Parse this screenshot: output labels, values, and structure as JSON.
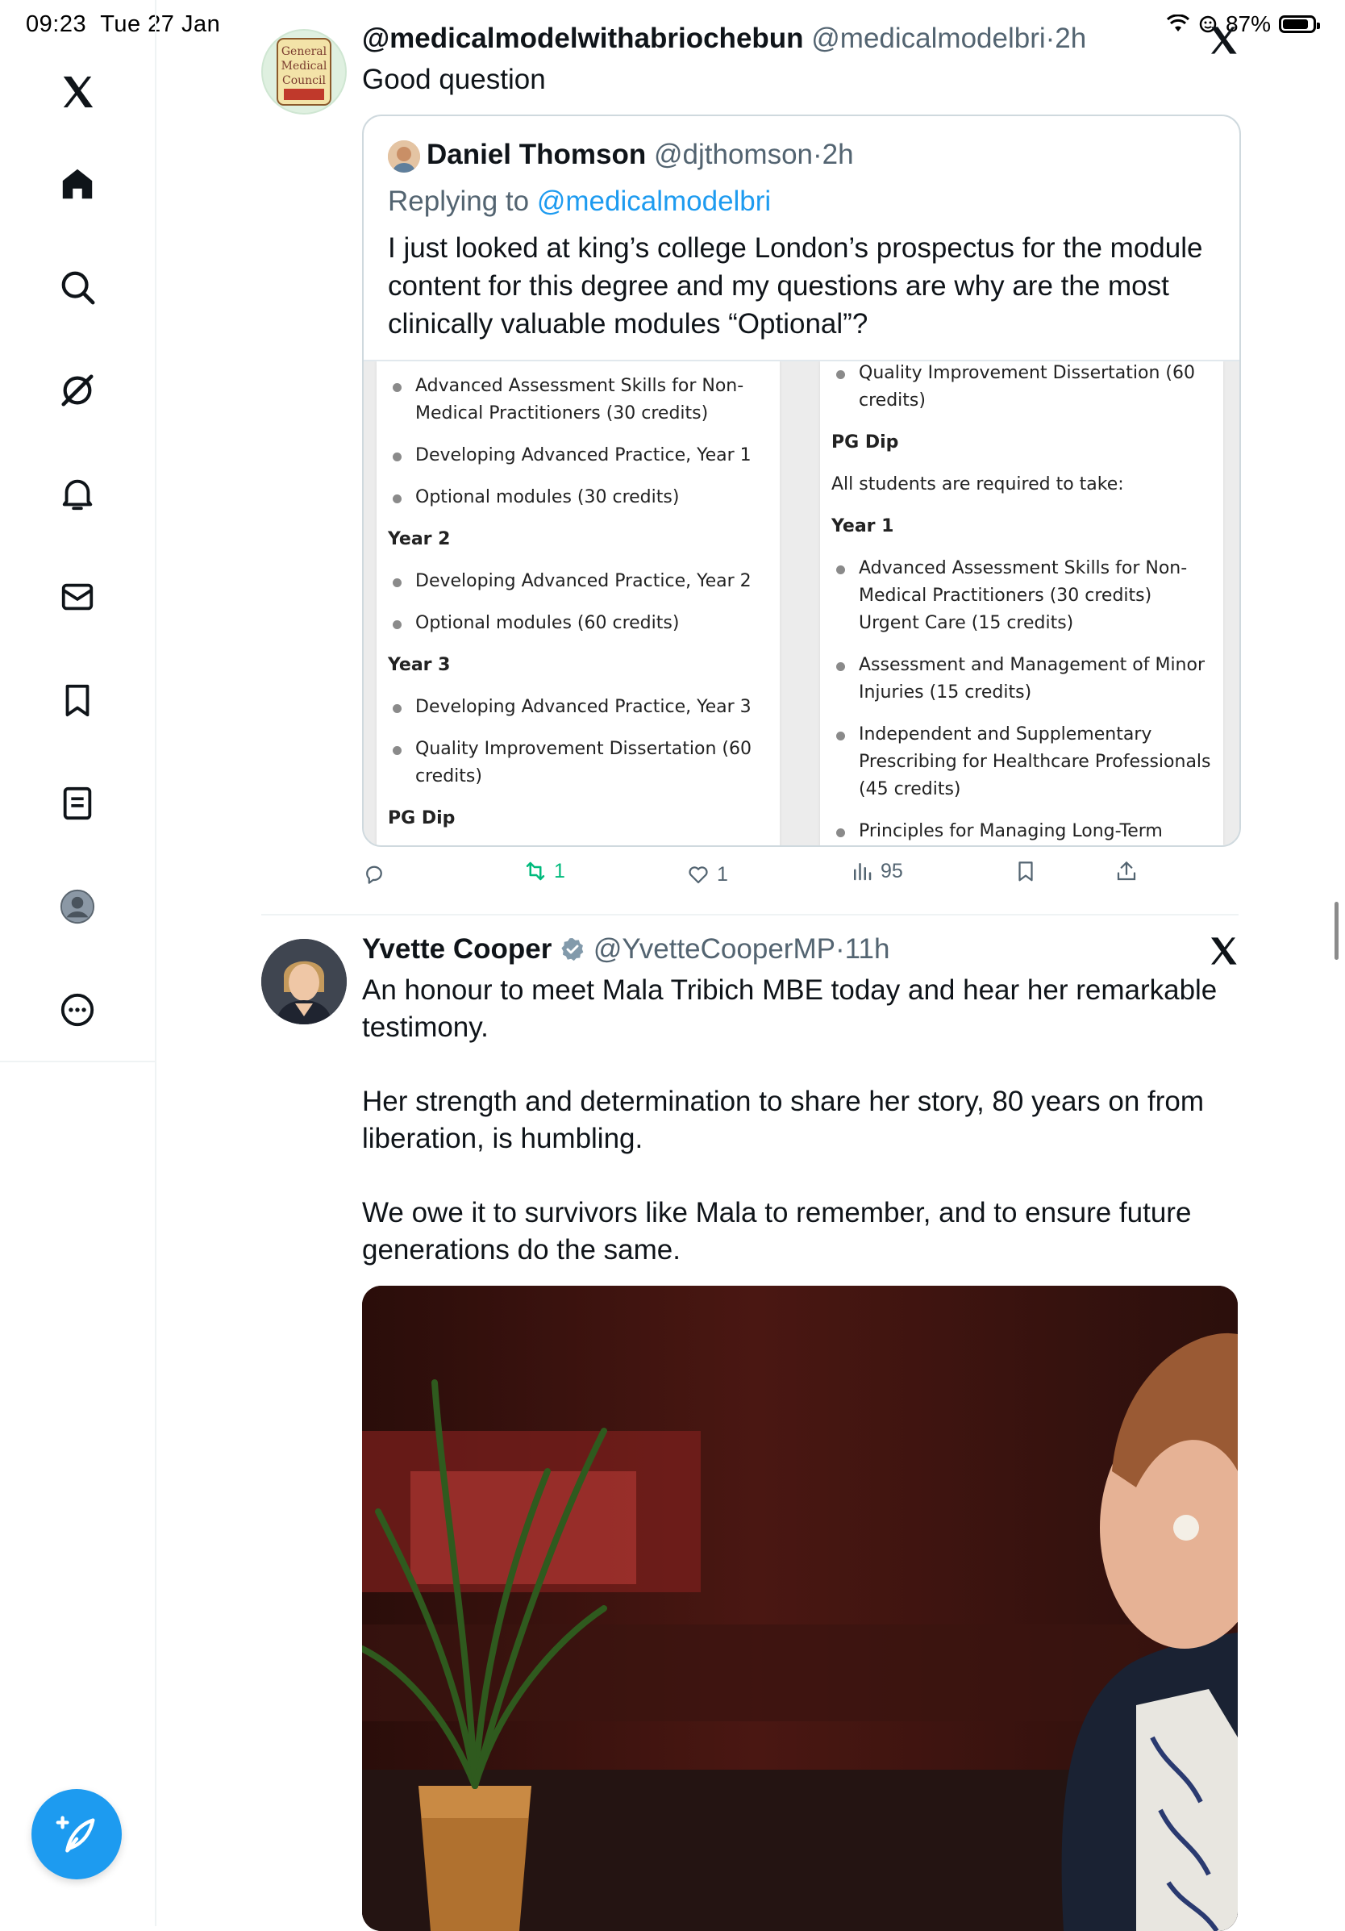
{
  "status_bar": {
    "time": "09:23",
    "date": "Tue 27 Jan",
    "battery": "87%",
    "battery_level": 0.87
  },
  "sidebar": {
    "items": [
      {
        "icon": "x-logo-icon"
      },
      {
        "icon": "home-icon"
      },
      {
        "icon": "search-icon"
      },
      {
        "icon": "grok-icon"
      },
      {
        "icon": "bell-icon"
      },
      {
        "icon": "mail-icon"
      },
      {
        "icon": "bookmark-icon"
      },
      {
        "icon": "lists-icon"
      },
      {
        "icon": "profile-avatar-icon"
      },
      {
        "icon": "more-icon"
      }
    ],
    "compose_icon": "compose-icon",
    "accent": "#1d9bf0"
  },
  "tweets": [
    {
      "display_name": "@medicalmodelwithabriochebun",
      "handle": "@medicalmodelbri",
      "sep": "·",
      "time": "2h",
      "avatar_text": [
        "General",
        "Medical",
        "Council"
      ],
      "text": "Good question",
      "quote": {
        "display_name": "Daniel Thomson",
        "handle": "@djthomson",
        "sep": "·",
        "time": "2h",
        "replying_prefix": "Replying to",
        "replying_to": "@medicalmodelbri",
        "text": "I just looked at king’s college London’s prospectus for the module content for this degree and my questions are why are the most clinically valuable modules “Optional”?",
        "image_left": [
          {
            "kind": "bullet",
            "text": "Advanced Assessment Skills for Non-"
          },
          {
            "kind": "cont",
            "text": "Medical Practitioners (30 credits)"
          },
          {
            "kind": "bullet",
            "text": "Developing Advanced Practice, Year 1"
          },
          {
            "kind": "bullet",
            "text": "Optional modules (30 credits)"
          },
          {
            "kind": "head",
            "text": "Year 2"
          },
          {
            "kind": "bullet",
            "text": "Developing Advanced Practice, Year 2"
          },
          {
            "kind": "bullet",
            "text": "Optional modules (60 credits)"
          },
          {
            "kind": "head",
            "text": "Year 3"
          },
          {
            "kind": "bullet",
            "text": "Developing Advanced Practice, Year 3"
          },
          {
            "kind": "bullet",
            "text": "Quality Improvement Dissertation (60"
          },
          {
            "kind": "cont",
            "text": "credits)"
          },
          {
            "kind": "head",
            "text": "PG Dip"
          }
        ],
        "image_right": [
          {
            "kind": "bullet",
            "text": "Quality Improvement Dissertation (60"
          },
          {
            "kind": "cont",
            "text": "credits)"
          },
          {
            "kind": "head",
            "text": "PG Dip"
          },
          {
            "kind": "plain",
            "text": "All students are required to take:"
          },
          {
            "kind": "head",
            "text": "Year 1"
          },
          {
            "kind": "bullet",
            "text": "Advanced Assessment Skills for Non-"
          },
          {
            "kind": "cont",
            "text": "Medical Practitioners (30 credits)"
          },
          {
            "kind": "cont",
            "text": "Urgent Care (15 credits)"
          },
          {
            "kind": "bullet",
            "text": "Assessment and Management of Minor"
          },
          {
            "kind": "cont",
            "text": "Injuries (15 credits)"
          },
          {
            "kind": "bullet",
            "text": "Independent and Supplementary"
          },
          {
            "kind": "cont",
            "text": "Prescribing for Healthcare Professionals"
          },
          {
            "kind": "cont",
            "text": "(45 credits)"
          },
          {
            "kind": "bullet",
            "text": "Principles for Managing Long-Term"
          }
        ]
      },
      "actions": {
        "replies": "",
        "retweets": "1",
        "likes": "1",
        "views": "95"
      }
    },
    {
      "display_name": "Yvette Cooper",
      "verified": true,
      "handle": "@YvetteCooperMP",
      "sep": "·",
      "time": "11h",
      "paragraphs": [
        "An honour to meet Mala Tribich MBE today and hear her remarkable testimony.",
        "Her strength and determination to share her story, 80 years on from liberation, is humbling.",
        "We owe it to survivors like Mala to remember, and to ensure future generations do the same."
      ]
    }
  ]
}
